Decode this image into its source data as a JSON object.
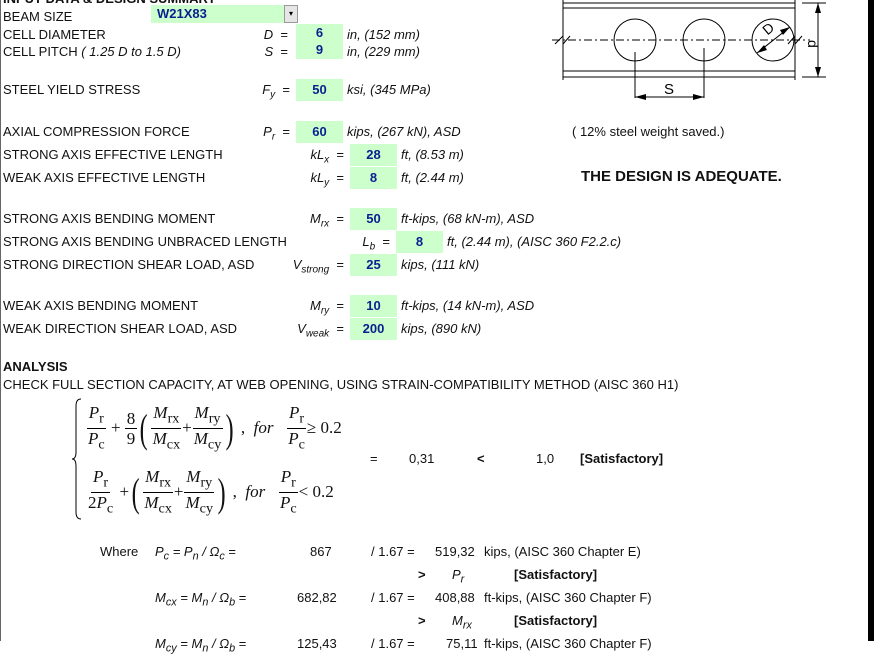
{
  "section_title": "INPUT DATA & DESIGN SUMMARY",
  "beam_size": {
    "label": "BEAM SIZE",
    "value": "W21X83",
    "dropdown_icon": "▾"
  },
  "inputs": [
    {
      "label": "CELL DIAMETER",
      "symbol": "D",
      "sub": "",
      "eq": "=",
      "value": "6",
      "unit": "in, (152 mm)"
    },
    {
      "label": "CELL PITCH",
      "label_note": "( 1.25 D to 1.5 D)",
      "symbol": "S",
      "sub": "",
      "eq": "=",
      "value": "9",
      "unit": "in, (229 mm)"
    },
    {
      "label": "STEEL YIELD STRESS",
      "symbol": "F",
      "sub": "y",
      "eq": "=",
      "value": "50",
      "unit": "ksi, (345 MPa)"
    },
    {
      "label": "AXIAL COMPRESSION FORCE",
      "symbol": "P",
      "sub": "r",
      "eq": "=",
      "value": "60",
      "unit": "kips, (267 kN), ASD"
    },
    {
      "label": "STRONG AXIS EFFECTIVE LENGTH",
      "symbol": "kL",
      "sub": "x",
      "eq": "=",
      "value": "28",
      "unit": "ft, (8.53 m)"
    },
    {
      "label": "WEAK AXIS EFFECTIVE LENGTH",
      "symbol": "kL",
      "sub": "y",
      "eq": "=",
      "value": "8",
      "unit": "ft, (2.44 m)"
    },
    {
      "label": "STRONG AXIS BENDING MOMENT",
      "symbol": "M",
      "sub": "rx",
      "eq": "=",
      "value": "50",
      "unit": "ft-kips, (68 kN-m), ASD"
    },
    {
      "label": "STRONG AXIS BENDING UNBRACED LENGTH",
      "symbol": "L",
      "sub": "b",
      "eq": "=",
      "value": "8",
      "unit": "ft, (2.44 m), (AISC 360 F2.2.c)"
    },
    {
      "label": "STRONG DIRECTION SHEAR LOAD, ASD",
      "symbol": "V",
      "sub": "strong",
      "eq": "=",
      "value": "25",
      "unit": "kips, (111 kN)"
    },
    {
      "label": "WEAK AXIS BENDING MOMENT",
      "symbol": "M",
      "sub": "ry",
      "eq": "=",
      "value": "10",
      "unit": "ft-kips, (14 kN-m), ASD"
    },
    {
      "label": "WEAK DIRECTION SHEAR LOAD, ASD",
      "symbol": "V",
      "sub": "weak",
      "eq": "=",
      "value": "200",
      "unit": "kips, (890 kN)"
    }
  ],
  "diagram": {
    "label_D": "D",
    "label_S": "S",
    "label_d": "d"
  },
  "summary": {
    "weight_saved": "( 12% steel weight saved.)",
    "verdict": "THE DESIGN IS ADEQUATE."
  },
  "analysis": {
    "title": "ANALYSIS",
    "subtitle": "CHECK FULL SECTION CAPACITY, AT WEB OPENING, USING STRAIN-COMPATIBILITY METHOD (AISC 360 H1)",
    "formula": {
      "Pr": "P",
      "Pr_sub": "r",
      "Pc": "P",
      "Pc_sub": "c",
      "two": "2",
      "eight": "8",
      "nine": "9",
      "Mrx": "M",
      "Mrx_sub": "rx",
      "Mcx": "M",
      "Mcx_sub": "cx",
      "Mry": "M",
      "Mry_sub": "ry",
      "Mcy": "M",
      "Mcy_sub": "cy",
      "plus": "+",
      "comma": ",",
      "for": "for",
      "ge": "≥ 0.2",
      "lt": "< 0.2"
    },
    "result": {
      "eq": "=",
      "value": "0,31",
      "cmp": "<",
      "limit": "1,0",
      "status": "[Satisfactory]"
    },
    "where_label": "Where",
    "checks": [
      {
        "lhs": "P",
        "lhs_sub": "c",
        "mid": "= P",
        "mid_sub": "n",
        "omega": " / Ω",
        "omega_sub": "c",
        "eq": " =",
        "nominal": "867",
        "div": "/ 1.67 =",
        "value": "519,32",
        "unit": "kips, (AISC 360 Chapter E)",
        "cmp": ">",
        "demand": "P",
        "demand_sub": "r",
        "status": "[Satisfactory]"
      },
      {
        "lhs": "M",
        "lhs_sub": "cx",
        "mid": "= M",
        "mid_sub": "n",
        "omega": " / Ω",
        "omega_sub": "b",
        "eq": " =",
        "nominal": "682,82",
        "div": "/ 1.67 =",
        "value": "408,88",
        "unit": "ft-kips, (AISC 360 Chapter F)",
        "cmp": ">",
        "demand": "M",
        "demand_sub": "rx",
        "status": "[Satisfactory]"
      },
      {
        "lhs": "M",
        "lhs_sub": "cy",
        "mid": "= M",
        "mid_sub": "n",
        "omega": " / Ω",
        "omega_sub": "b",
        "eq": " =",
        "nominal": "125,43",
        "div": "/ 1.67 =",
        "value": "75,11",
        "unit": "ft-kips, (AISC 360 Chapter F)"
      }
    ]
  }
}
